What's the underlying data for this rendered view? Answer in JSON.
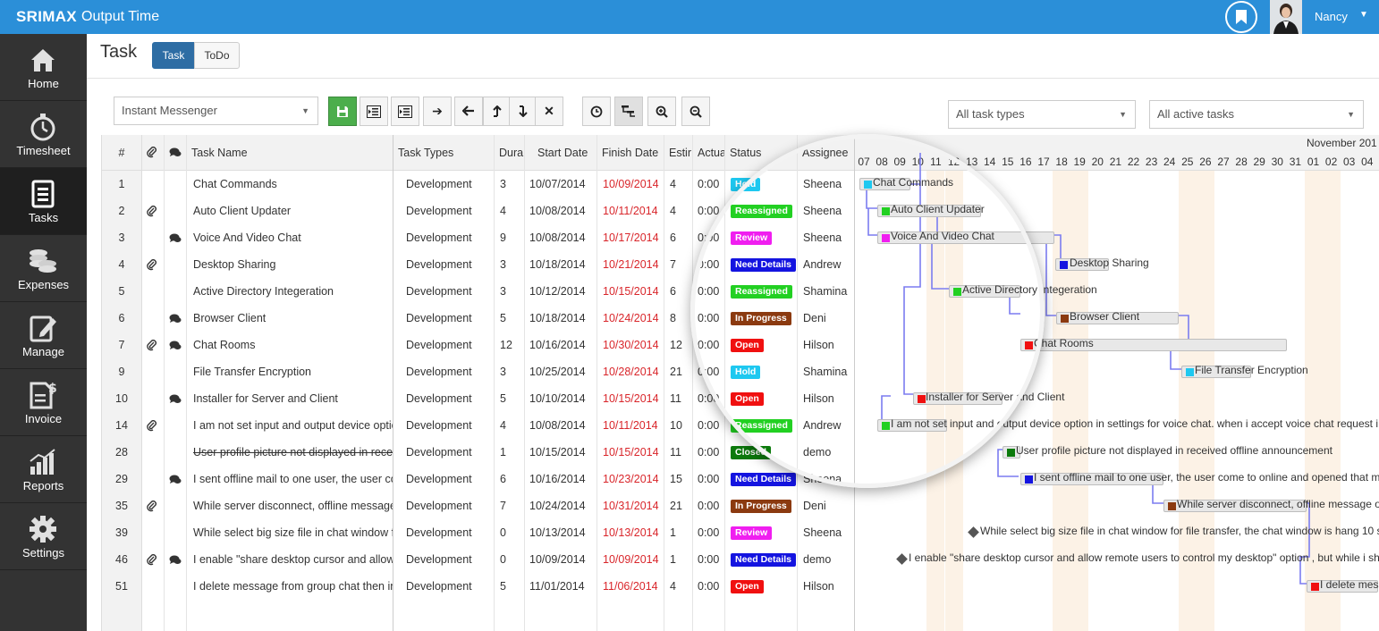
{
  "app": {
    "brand": "SRIMAX",
    "title": "Output Time"
  },
  "user": {
    "name": "Nancy"
  },
  "nav": [
    {
      "label": "Home",
      "icon": "home-icon"
    },
    {
      "label": "Timesheet",
      "icon": "stopwatch-icon"
    },
    {
      "label": "Tasks",
      "icon": "tasks-icon"
    },
    {
      "label": "Expenses",
      "icon": "coins-icon"
    },
    {
      "label": "Manage",
      "icon": "edit-icon"
    },
    {
      "label": "Invoice",
      "icon": "invoice-icon"
    },
    {
      "label": "Reports",
      "icon": "chart-icon"
    },
    {
      "label": "Settings",
      "icon": "gear-icon"
    }
  ],
  "page": {
    "title": "Task",
    "tabs": [
      "Task",
      "ToDo"
    ]
  },
  "toolbar": {
    "project": "Instant Messenger",
    "filter_types": "All task types",
    "filter_status": "All active tasks"
  },
  "columns": [
    "#",
    "",
    "",
    "Task Name",
    "Task Types",
    "Dura",
    "Start Date",
    "Finish Date",
    "Estir",
    "Actua",
    "Status",
    "Assignee"
  ],
  "rows": [
    {
      "num": "1",
      "attach": false,
      "comment": false,
      "name": "Chat Commands",
      "type": "Development",
      "dur": "3",
      "start": "10/07/2014",
      "finish": "10/09/2014",
      "est": "4",
      "act": "0:00",
      "status": "Hold",
      "assignee": "Sheena"
    },
    {
      "num": "2",
      "attach": true,
      "comment": false,
      "name": "Auto Client Updater",
      "type": "Development",
      "dur": "4",
      "start": "10/08/2014",
      "finish": "10/11/2014",
      "est": "4",
      "act": "0:00",
      "status": "Reassigned",
      "assignee": "Sheena"
    },
    {
      "num": "3",
      "attach": false,
      "comment": true,
      "name": "Voice And Video Chat",
      "type": "Development",
      "dur": "9",
      "start": "10/08/2014",
      "finish": "10/17/2014",
      "est": "6",
      "act": "0:00",
      "status": "Review",
      "assignee": "Sheena"
    },
    {
      "num": "4",
      "attach": true,
      "comment": false,
      "name": "Desktop Sharing",
      "type": "Development",
      "dur": "3",
      "start": "10/18/2014",
      "finish": "10/21/2014",
      "est": "7",
      "act": "0:00",
      "status": "Need Details",
      "assignee": "Andrew"
    },
    {
      "num": "5",
      "attach": false,
      "comment": false,
      "name": "Active Directory Integeration",
      "type": "Development",
      "dur": "3",
      "start": "10/12/2014",
      "finish": "10/15/2014",
      "est": "6",
      "act": "0:00",
      "status": "Reassigned",
      "assignee": "Shamina"
    },
    {
      "num": "6",
      "attach": false,
      "comment": true,
      "name": "Browser Client",
      "type": "Development",
      "dur": "5",
      "start": "10/18/2014",
      "finish": "10/24/2014",
      "est": "8",
      "act": "0:00",
      "status": "In Progress",
      "assignee": "Deni"
    },
    {
      "num": "7",
      "attach": true,
      "comment": true,
      "name": "Chat Rooms",
      "type": "Development",
      "dur": "12",
      "start": "10/16/2014",
      "finish": "10/30/2014",
      "est": "12",
      "act": "0:00",
      "status": "Open",
      "assignee": "Hilson"
    },
    {
      "num": "9",
      "attach": false,
      "comment": false,
      "name": "File Transfer Encryption",
      "type": "Development",
      "dur": "3",
      "start": "10/25/2014",
      "finish": "10/28/2014",
      "est": "21",
      "act": "0:00",
      "status": "Hold",
      "assignee": "Shamina"
    },
    {
      "num": "10",
      "attach": false,
      "comment": true,
      "name": "Installer for Server and Client",
      "type": "Development",
      "dur": "5",
      "start": "10/10/2014",
      "finish": "10/15/2014",
      "est": "11",
      "act": "0:00",
      "status": "Open",
      "assignee": "Hilson"
    },
    {
      "num": "14",
      "attach": true,
      "comment": false,
      "name": "I am not set input and output device option",
      "type": "Development",
      "dur": "4",
      "start": "10/08/2014",
      "finish": "10/11/2014",
      "est": "10",
      "act": "0:00",
      "status": "Reassigned",
      "assignee": "Andrew"
    },
    {
      "num": "28",
      "attach": false,
      "comment": false,
      "name": "User profile picture not displayed in received",
      "type": "Development",
      "dur": "1",
      "start": "10/15/2014",
      "finish": "10/15/2014",
      "est": "11",
      "act": "0:00",
      "status": "Closed",
      "assignee": "demo",
      "strike": true
    },
    {
      "num": "29",
      "attach": false,
      "comment": true,
      "name": "I sent offline mail to one user, the user come",
      "type": "Development",
      "dur": "6",
      "start": "10/16/2014",
      "finish": "10/23/2014",
      "est": "15",
      "act": "0:00",
      "status": "Need Details",
      "assignee": "Sheena"
    },
    {
      "num": "35",
      "attach": true,
      "comment": false,
      "name": "While server disconnect, offline message on",
      "type": "Development",
      "dur": "7",
      "start": "10/24/2014",
      "finish": "10/31/2014",
      "est": "21",
      "act": "0:00",
      "status": "In Progress",
      "assignee": "Deni"
    },
    {
      "num": "39",
      "attach": false,
      "comment": false,
      "name": "While select big size file in chat window for",
      "type": "Development",
      "dur": "0",
      "start": "10/13/2014",
      "finish": "10/13/2014",
      "est": "1",
      "act": "0:00",
      "status": "Review",
      "assignee": "Sheena"
    },
    {
      "num": "46",
      "attach": true,
      "comment": true,
      "name": "I enable \"share desktop cursor and allow remote",
      "type": "Development",
      "dur": "0",
      "start": "10/09/2014",
      "finish": "10/09/2014",
      "est": "1",
      "act": "0:00",
      "status": "Need Details",
      "assignee": "demo"
    },
    {
      "num": "51",
      "attach": false,
      "comment": false,
      "name": "I delete message from group chat then in",
      "type": "Development",
      "dur": "5",
      "start": "11/01/2014",
      "finish": "11/06/2014",
      "est": "4",
      "act": "0:00",
      "status": "Open",
      "assignee": "Hilson"
    }
  ],
  "status_colors": {
    "Hold": "#1ec8f0",
    "Reassigned": "#22d022",
    "Review": "#f01ef0",
    "Need Details": "#1414e0",
    "In Progress": "#8b3a10",
    "Open": "#f01010",
    "Closed": "#0c7a0c"
  },
  "gantt": {
    "month_label": "November 201",
    "days": [
      "07",
      "08",
      "09",
      "10",
      "11",
      "12",
      "13",
      "14",
      "15",
      "16",
      "17",
      "18",
      "19",
      "20",
      "21",
      "22",
      "23",
      "24",
      "25",
      "26",
      "27",
      "28",
      "29",
      "30",
      "31",
      "01",
      "02",
      "03",
      "04"
    ],
    "weekend_days": [
      "11",
      "12",
      "18",
      "19",
      "25",
      "26",
      "01",
      "02"
    ],
    "bars": [
      {
        "label": "Chat Commands",
        "color": "#1ec8f0"
      },
      {
        "label": "Auto Client Updater",
        "color": "#22d022"
      },
      {
        "label": "Voice And Video Chat",
        "color": "#f01ef0"
      },
      {
        "label": "Desktop Sharing",
        "color": "#1414e0"
      },
      {
        "label": "Active Directory Integeration",
        "color": "#22d022"
      },
      {
        "label": "Browser Client",
        "color": "#8b3a10"
      },
      {
        "label": "Chat Rooms",
        "color": "#f01010"
      },
      {
        "label": "File Transfer Encryption",
        "color": "#1ec8f0"
      },
      {
        "label": "Installer for Server and Client",
        "color": "#f01010"
      },
      {
        "label": "I am not set input and output device option in settings for voice chat. when i accept voice chat request i g",
        "color": "#22d022"
      },
      {
        "label": "User profile picture not displayed in received offline announcement",
        "color": "#0c7a0c"
      },
      {
        "label": "I sent offline mail to one user, the user come to online and opened that m",
        "color": "#1414e0"
      },
      {
        "label": "While server disconnect, offline message on",
        "color": "#8b3a10"
      },
      {
        "label": "While select big size file in chat window for file transfer, the chat window is hang 10 se",
        "color": "#555555"
      },
      {
        "label": "I enable \"share desktop cursor and allow remote users to control my desktop\" option , but while i sh",
        "color": "#555555"
      },
      {
        "label": "I delete mess",
        "color": "#f01010"
      }
    ]
  }
}
